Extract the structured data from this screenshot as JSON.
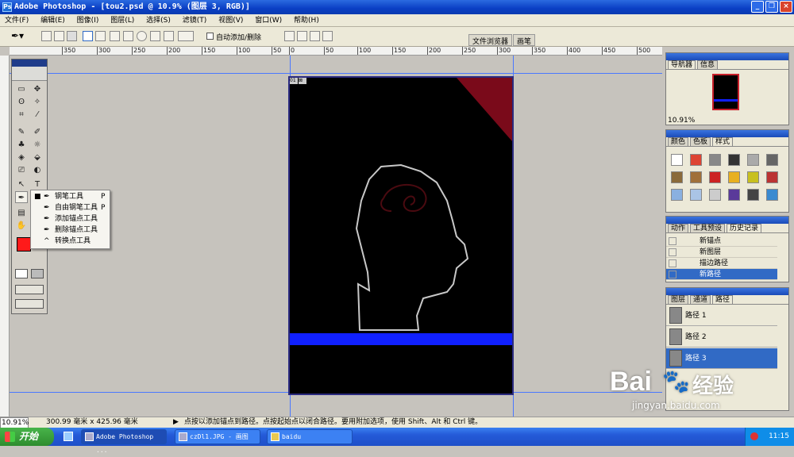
{
  "app": {
    "title": "Adobe Photoshop - [tou2.psd @ 10.9% (图层 3, RGB)]",
    "window_buttons": [
      "_",
      "❐",
      "×"
    ]
  },
  "menu": [
    "文件(F)",
    "编辑(E)",
    "图像(I)",
    "图层(L)",
    "选择(S)",
    "滤镜(T)",
    "视图(V)",
    "窗口(W)",
    "帮助(H)"
  ],
  "options": {
    "auto_add_delete": "自动添加/删除",
    "well_tabs": [
      "文件浏览器",
      "画笔"
    ]
  },
  "ruler": {
    "top_ticks": [
      "350",
      "300",
      "250",
      "200",
      "150",
      "100",
      "50",
      "0",
      "50",
      "100",
      "150",
      "200",
      "250",
      "300",
      "350",
      "400",
      "450",
      "500",
      "550"
    ],
    "left_ticks": [
      "0",
      "5",
      "0",
      "1",
      "0",
      "0",
      "1",
      "5",
      "0",
      "2",
      "0",
      "0",
      "2",
      "5",
      "0",
      "3",
      "0",
      "0",
      "3",
      "5",
      "0",
      "4",
      "0"
    ]
  },
  "canvas": {
    "badges": [
      "01",
      "⊠"
    ]
  },
  "toolbox": {
    "tools": [
      "▭",
      "✥",
      "ʘ",
      "✧",
      "⌗",
      "⁄",
      "✎",
      "✐",
      "♣",
      "☼",
      "◈",
      "⬙",
      "⎚",
      "◐",
      "⊿",
      "●",
      "↖",
      "T",
      "✒",
      "▢",
      "▤",
      "✋",
      "🔍"
    ]
  },
  "flyout": {
    "items": [
      {
        "icon": "✒",
        "label": "钢笔工具",
        "key": "P",
        "selected": true
      },
      {
        "icon": "✒",
        "label": "自由钢笔工具",
        "key": "P",
        "selected": false
      },
      {
        "icon": "✒",
        "label": "添加锚点工具",
        "key": "",
        "selected": false
      },
      {
        "icon": "✒",
        "label": "删除锚点工具",
        "key": "",
        "selected": false
      },
      {
        "icon": "^",
        "label": "转换点工具",
        "key": "",
        "selected": false
      }
    ]
  },
  "colors": {
    "foreground": "#ff1a1a",
    "background": "#1a2cff",
    "canvas_bg": "#000000",
    "red_triangle": "#7a0a1a",
    "blue_band": "#1020ff",
    "path_stroke": "#c8c8c8",
    "selection_blue": "#316ac5"
  },
  "navigator": {
    "tabs": [
      "导航器",
      "信息"
    ],
    "zoom": "10.91%"
  },
  "swatches_panel": {
    "tabs": [
      "颜色",
      "色板",
      "样式"
    ]
  },
  "history": {
    "tabs": [
      "动作",
      "工具预设",
      "历史记录"
    ],
    "items": [
      "新锚点",
      "新图层",
      "描边路径",
      "新路径"
    ],
    "active_index": 3
  },
  "paths": {
    "tabs": [
      "图层",
      "通道",
      "路径"
    ],
    "items": [
      "路径 1",
      "路径 2",
      "路径 3"
    ],
    "active_index": 2
  },
  "status": {
    "zoom": "10.91%",
    "doc_size": "300.99 毫米 x 425.96 毫米",
    "hint": "点按以添加锚点到路径。点按起始点以闭合路径。要用附加选项，使用 Shift、Alt 和 Ctrl 键。"
  },
  "taskbar": {
    "start": "开始",
    "tasks": [
      "Adobe Photoshop ...",
      "czDl1.JPG - 画图",
      "baidu"
    ],
    "active_index": 0,
    "clock": "11:15"
  },
  "watermark": {
    "logo": "Bai",
    "logo_suffix": "经验",
    "url": "jingyan.baidu.com"
  }
}
